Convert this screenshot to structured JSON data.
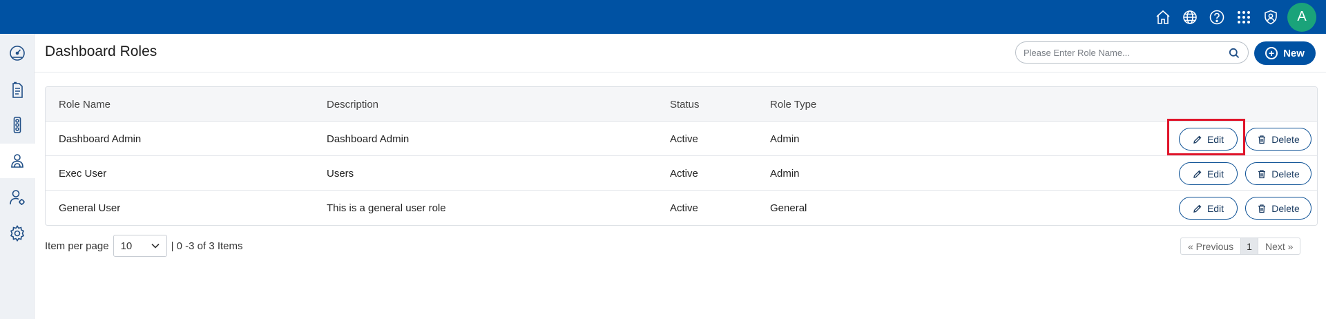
{
  "topbar": {
    "icons": [
      "home-icon",
      "globe-icon",
      "help-icon",
      "apps-grid-icon",
      "security-user-icon"
    ],
    "avatar_letter": "A",
    "bar_color": "#0052a3",
    "avatar_color": "#1aa37a"
  },
  "sidebar": {
    "items": [
      {
        "icon": "dashboard-gauge-icon",
        "active": false
      },
      {
        "icon": "document-icon",
        "active": false
      },
      {
        "icon": "traffic-light-icon",
        "active": false
      },
      {
        "icon": "roles-icon",
        "active": true
      },
      {
        "icon": "user-settings-icon",
        "active": false
      },
      {
        "icon": "settings-gear-icon",
        "active": false
      }
    ]
  },
  "header": {
    "title": "Dashboard Roles",
    "search_placeholder": "Please Enter Role Name...",
    "new_label": "New"
  },
  "table": {
    "columns": [
      "Role Name",
      "Description",
      "Status",
      "Role Type"
    ],
    "rows": [
      {
        "name": "Dashboard Admin",
        "description": "Dashboard Admin",
        "status": "Active",
        "role_type": "Admin"
      },
      {
        "name": "Exec User",
        "description": "Users",
        "status": "Active",
        "role_type": "Admin"
      },
      {
        "name": "General User",
        "description": "This is a general user role",
        "status": "Active",
        "role_type": "General"
      }
    ],
    "edit_label": "Edit",
    "delete_label": "Delete"
  },
  "footer": {
    "per_page_label": "Item per page",
    "per_page_value": "10",
    "items_summary": "| 0 -3 of 3 Items",
    "prev_label": "«  Previous",
    "current_page": "1",
    "next_label": "Next  »"
  },
  "accent_color": "#0052a3",
  "highlight_color": "#e0142a"
}
